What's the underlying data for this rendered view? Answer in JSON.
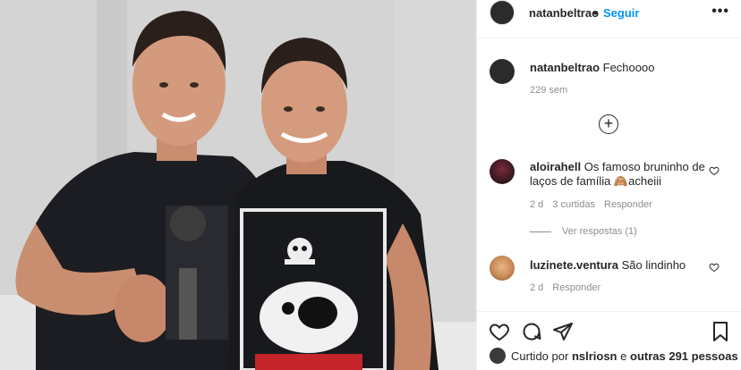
{
  "post": {
    "username": "natanbeltrao",
    "follow_label": "Seguir",
    "more_label": "•••",
    "dot": "•"
  },
  "caption": {
    "username": "natanbeltrao",
    "text": "Fechoooo",
    "time": "229 sem"
  },
  "load_more_label": "+",
  "comments": [
    {
      "username": "aloirahell",
      "text": "Os famoso bruninho de laços de família 🙈acheiii",
      "time": "2 d",
      "likes": "3 curtidas",
      "reply_label": "Responder",
      "view_replies": "Ver respostas (1)"
    },
    {
      "username": "luzinete.ventura",
      "text": "São lindinho",
      "time": "2 d",
      "reply_label": "Responder"
    }
  ],
  "likes_summary": {
    "prefix": "Curtido por",
    "user": "nslriosn",
    "middle": "e",
    "others": "outras 291 pessoas"
  },
  "icons": {
    "like": "heart-icon",
    "comment": "comment-icon",
    "share": "share-icon",
    "save": "bookmark-icon",
    "more": "more-icon"
  },
  "colors": {
    "link": "#0095f6",
    "text": "#262626",
    "muted": "#8e8e8e",
    "border": "#efefef"
  }
}
